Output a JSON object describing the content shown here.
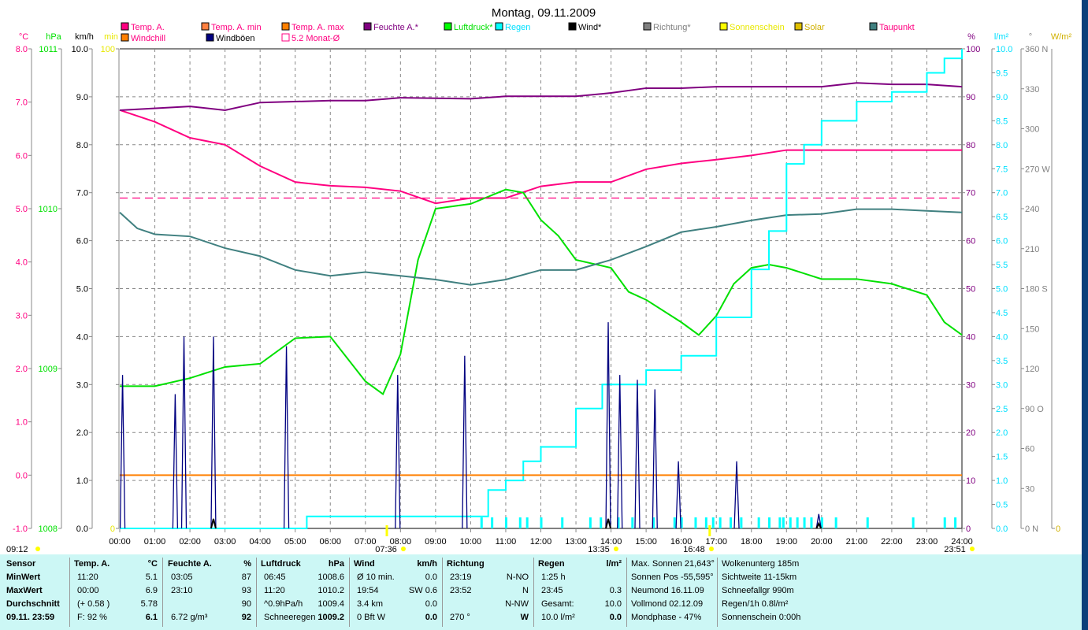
{
  "title": "Montag, 09.11.2009",
  "legend": [
    {
      "label": "Temp. A.",
      "color": "#ff0080",
      "text": "#ff0080"
    },
    {
      "label": "Temp. A. min",
      "color": "#ff8040",
      "text": "#ff0080"
    },
    {
      "label": "Temp. A. max",
      "color": "#ff8000",
      "text": "#ff0080"
    },
    {
      "label": "Feuchte A.*",
      "color": "#800080",
      "text": "#800080"
    },
    {
      "label": "Luftdruck*",
      "color": "#00ff00",
      "text": "#00e000"
    },
    {
      "label": "Regen",
      "color": "#00ffff",
      "text": "#00e0ff"
    },
    {
      "label": "Wind*",
      "color": "#000000",
      "text": "#000000"
    },
    {
      "label": "Richtung*",
      "color": "#808080",
      "text": "#808080"
    },
    {
      "label": "Sonnenschein",
      "color": "#ffff00",
      "text": "#e8e800"
    },
    {
      "label": "Solar",
      "color": "#e0c000",
      "text": "#d0b000"
    },
    {
      "label": "Taupunkt",
      "color": "#408080",
      "text": "#ff0080"
    },
    {
      "label": "Windchill",
      "color": "#ff8000",
      "text": "#ff0080"
    },
    {
      "label": "Windböen",
      "color": "#000080",
      "text": "#000000"
    },
    {
      "label": "5.2 Monat-Ø",
      "color": "#ff0080",
      "text": "#ff0080"
    }
  ],
  "axes": {
    "left": [
      {
        "unit": "°C",
        "color": "#ff0080",
        "ticks": [
          "8.0",
          "7.0",
          "6.0",
          "5.0",
          "4.0",
          "3.0",
          "2.0",
          "1.0",
          "0.0",
          "-1.0"
        ]
      },
      {
        "unit": "hPa",
        "color": "#00e000",
        "ticks": [
          "1011",
          "1010",
          "1009",
          "1008"
        ]
      },
      {
        "unit": "km/h",
        "color": "#000000",
        "ticks": [
          "10.0",
          "9.0",
          "8.0",
          "7.0",
          "6.0",
          "5.0",
          "4.0",
          "3.0",
          "2.0",
          "1.0",
          "0.0"
        ]
      },
      {
        "unit": "min",
        "color": "#e8e800",
        "ticks": [
          "100",
          "",
          "",
          "",
          "",
          "",
          "",
          "",
          "",
          "",
          "0"
        ]
      }
    ],
    "right": [
      {
        "unit": "%",
        "color": "#800080",
        "ticks": [
          "100",
          "90",
          "80",
          "70",
          "60",
          "50",
          "40",
          "30",
          "20",
          "10",
          "0"
        ]
      },
      {
        "unit": "l/m²",
        "color": "#00e0ff",
        "ticks": [
          "10.0",
          "9.5",
          "9.0",
          "8.5",
          "8.0",
          "7.5",
          "7.0",
          "6.5",
          "6.0",
          "5.5",
          "5.0",
          "4.5",
          "4.0",
          "3.5",
          "3.0",
          "2.5",
          "2.0",
          "1.5",
          "1.0",
          "0.5",
          "0.0"
        ]
      },
      {
        "unit": "°",
        "color": "#808080",
        "ticks": [
          "360 N",
          "330",
          "300",
          "270 W",
          "240",
          "210",
          "180 S",
          "150",
          "120",
          "90 O",
          "60",
          "30",
          "0    N"
        ]
      },
      {
        "unit": "W/m²",
        "color": "#d0b000",
        "ticks": [
          "0"
        ]
      }
    ]
  },
  "time_labels": [
    "00:00",
    "01:00",
    "02:00",
    "03:00",
    "04:00",
    "05:00",
    "06:00",
    "07:00",
    "08:00",
    "09:00",
    "10:00",
    "11:00",
    "12:00",
    "13:00",
    "14:00",
    "15:00",
    "16:00",
    "17:00",
    "18:00",
    "19:00",
    "20:00",
    "21:00",
    "22:00",
    "23:00",
    "24:00"
  ],
  "sun_markers": [
    "09:12",
    "07:36",
    "13:35",
    "16:48",
    "23:51"
  ],
  "chart_data": {
    "type": "line",
    "title": "Montag, 09.11.2009",
    "x_unit": "hours",
    "series": [
      {
        "name": "Temp. A.",
        "unit": "°C",
        "color": "#ff0080",
        "x": [
          0,
          1,
          2,
          3,
          4,
          5,
          6,
          7,
          8,
          9,
          10,
          11,
          12,
          13,
          14,
          15,
          16,
          17,
          18,
          19,
          20,
          21,
          22,
          23,
          24
        ],
        "y": [
          6.85,
          6.63,
          6.33,
          6.2,
          5.8,
          5.5,
          5.43,
          5.4,
          5.33,
          5.1,
          5.2,
          5.2,
          5.42,
          5.5,
          5.5,
          5.74,
          5.85,
          5.92,
          6.0,
          6.1,
          6.1,
          6.1,
          6.1,
          6.1,
          6.1
        ]
      },
      {
        "name": "Feuchte A.*",
        "unit": "%",
        "color": "#800080",
        "x": [
          0,
          2,
          3,
          4,
          6,
          7,
          8,
          10,
          11,
          13,
          14,
          15,
          16,
          17,
          20,
          21,
          22,
          23,
          24
        ],
        "y": [
          87.2,
          88,
          87.2,
          88.8,
          89.2,
          89.2,
          89.8,
          89.6,
          90.1,
          90.1,
          90.8,
          91.8,
          91.8,
          92.1,
          92.1,
          92.9,
          92.6,
          92.6,
          92.1
        ]
      },
      {
        "name": "Luftdruck*",
        "unit": "hPa",
        "color": "#00e000",
        "x": [
          0,
          1,
          2,
          3,
          4,
          5,
          6,
          7,
          7.5,
          8,
          8.5,
          9,
          10,
          11,
          11.5,
          12,
          12.5,
          13,
          14,
          14.5,
          15,
          16,
          16.5,
          17,
          17.5,
          18,
          18.5,
          19,
          20,
          21,
          22,
          23,
          23.5,
          24
        ],
        "y": [
          1008.89,
          1008.89,
          1008.94,
          1009.01,
          1009.03,
          1009.19,
          1009.2,
          1008.92,
          1008.84,
          1009.09,
          1009.68,
          1010.0,
          1010.03,
          1010.12,
          1010.1,
          1009.93,
          1009.83,
          1009.68,
          1009.63,
          1009.48,
          1009.43,
          1009.29,
          1009.21,
          1009.33,
          1009.53,
          1009.63,
          1009.65,
          1009.63,
          1009.56,
          1009.56,
          1009.53,
          1009.46,
          1009.29,
          1009.21
        ]
      },
      {
        "name": "Taupunkt",
        "unit": "°C",
        "color": "#408080",
        "x": [
          0,
          0.5,
          1,
          2,
          3,
          4,
          5,
          6,
          7,
          8,
          9,
          10,
          11,
          12,
          13,
          14,
          15,
          16,
          17,
          18,
          19,
          20,
          21,
          22,
          23,
          24
        ],
        "y": [
          4.93,
          4.63,
          4.52,
          4.48,
          4.26,
          4.11,
          3.85,
          3.74,
          3.81,
          3.74,
          3.67,
          3.57,
          3.67,
          3.85,
          3.85,
          4.04,
          4.29,
          4.56,
          4.66,
          4.78,
          4.88,
          4.9,
          4.99,
          4.99,
          4.96,
          4.93
        ]
      },
      {
        "name": "Regen",
        "unit": "l/m²",
        "color": "#00ffff",
        "x": [
          0,
          5.33,
          10.25,
          10.5,
          11,
          11.5,
          12,
          13,
          13.75,
          15,
          16,
          17,
          18,
          18.5,
          19,
          19.5,
          20,
          21,
          22,
          23,
          23.5,
          24
        ],
        "y": [
          0,
          0.25,
          0.25,
          0.8,
          1.0,
          1.4,
          1.7,
          2.5,
          3.0,
          3.3,
          3.6,
          4.4,
          5.4,
          6.2,
          7.6,
          8.0,
          8.5,
          8.9,
          9.1,
          9.5,
          9.8,
          10.0
        ]
      },
      {
        "name": "Windchill",
        "unit": "°C",
        "color": "#ff8000",
        "x": [
          0,
          24
        ],
        "y": [
          0.0,
          0.0
        ]
      },
      {
        "name": "5.2 Monat-Ø",
        "unit": "°C",
        "color": "#ff0080",
        "x": [
          0,
          24
        ],
        "y": [
          5.2,
          5.2
        ],
        "style": "dashed"
      },
      {
        "name": "Windböen",
        "unit": "km/h",
        "color": "#000080",
        "type": "spikes",
        "x": [
          0.08,
          1.58,
          1.83,
          2.67,
          4.75,
          7.92,
          9.83,
          13.92,
          14.25,
          14.75,
          15.25,
          15.92,
          17.58,
          19.92
        ],
        "y": [
          3.2,
          2.8,
          4.0,
          4.0,
          3.8,
          3.2,
          3.6,
          4.3,
          3.2,
          3.1,
          2.9,
          1.4,
          1.4,
          0.3
        ]
      },
      {
        "name": "Wind*",
        "unit": "km/h",
        "color": "#000000",
        "type": "spikes",
        "x": [
          2.67,
          13.92,
          19.92
        ],
        "y": [
          0.2,
          0.2,
          0.1
        ]
      }
    ],
    "rain_events": [
      10.3,
      10.6,
      11.0,
      11.4,
      11.6,
      12.0,
      12.6,
      13.4,
      13.7,
      14.2,
      14.6,
      15.2,
      15.8,
      16.0,
      16.4,
      16.7,
      16.9,
      17.1,
      17.4,
      17.7,
      18.2,
      18.5,
      18.8,
      18.9,
      19.1,
      19.3,
      19.5,
      19.7,
      20.0,
      20.4,
      21.3,
      22.6,
      23.5,
      23.8
    ],
    "sunshine_events": [
      7.6,
      16.8
    ],
    "xlim": [
      0,
      24
    ]
  },
  "table": {
    "sensor": {
      "header": "Sensor",
      "rows": [
        "MinWert",
        "MaxWert",
        "Durchschnitt",
        "09.11. 23:59"
      ]
    },
    "temp": {
      "header": "Temp. A.",
      "unit": "°C",
      "rows": [
        [
          "11:20",
          "5.1"
        ],
        [
          "00:00",
          "6.9"
        ],
        [
          "(+ 0.58 )",
          "5.78"
        ],
        [
          "F: 92 %",
          "6.1"
        ]
      ]
    },
    "feuchte": {
      "header": "Feuchte A.",
      "unit": "%",
      "rows": [
        [
          "03:05",
          "87"
        ],
        [
          "23:10",
          "93"
        ],
        [
          "",
          "90"
        ],
        [
          "6.72 g/m³",
          "92"
        ]
      ]
    },
    "luftdruck": {
      "header": "Luftdruck",
      "unit": "hPa",
      "rows": [
        [
          "06:45",
          "1008.6"
        ],
        [
          "11:20",
          "1010.2"
        ],
        [
          "^0.9hPa/h",
          "1009.4"
        ],
        [
          "Schneeregen",
          "1009.2"
        ]
      ]
    },
    "wind": {
      "header": "Wind",
      "unit": "km/h",
      "rows": [
        [
          "Ø 10 min.",
          "0.0"
        ],
        [
          "19:54",
          "SW 0.6"
        ],
        [
          "3.4 km",
          "0.0"
        ],
        [
          "0 Bft W",
          "0.0"
        ]
      ]
    },
    "richtung": {
      "header": "Richtung",
      "unit": "",
      "rows": [
        [
          "23:19",
          "N-NO"
        ],
        [
          "23:52",
          "N"
        ],
        [
          "",
          "N-NW"
        ],
        [
          "270 °",
          "W"
        ]
      ]
    },
    "regen": {
      "header": "Regen",
      "unit": "l/m²",
      "rows": [
        [
          "1:25 h",
          ""
        ],
        [
          "23:45",
          "0.3"
        ],
        [
          "Gesamt:",
          "10.0"
        ],
        [
          "10.0 l/m²",
          "0.0"
        ]
      ]
    },
    "astro": [
      "Max. Sonnen 21,643°",
      "Sonnen Pos  -55,595°",
      "Neumond     16.11.09",
      "Vollmond     02.12.09",
      "Mondphase       - 47%"
    ],
    "misc": [
      "Wolkenunterg   185m",
      "Sichtweite   11-15km",
      "Schneefallgr     990m",
      "Regen/1h      0.8l/m²",
      "Sonnenschein  0:00h"
    ]
  }
}
